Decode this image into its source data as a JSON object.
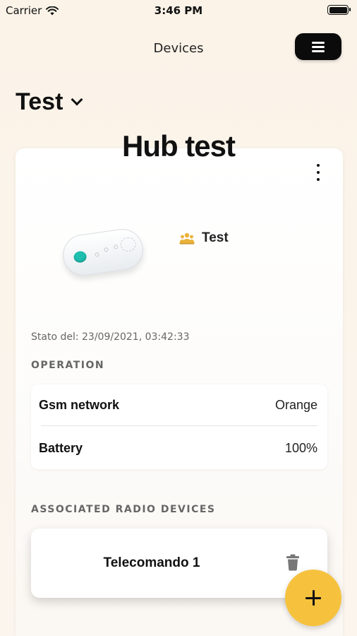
{
  "status_bar": {
    "carrier": "Carrier",
    "time": "3:46 PM",
    "wifi_icon": "wifi-icon",
    "battery_icon": "battery-icon"
  },
  "header": {
    "title": "Devices",
    "menu_icon": "menu-icon"
  },
  "site": {
    "name": "Test",
    "chevron_icon": "chevron-down-icon"
  },
  "hub": {
    "title": "Hub test",
    "more_icon": "more-vertical-icon",
    "owner_icon": "group-icon",
    "owner": "Test",
    "status_date": "Stato del: 23/09/2021, 03:42:33"
  },
  "operation": {
    "label": "OPERATION",
    "rows": [
      {
        "label": "Gsm network",
        "value": "Orange"
      },
      {
        "label": "Battery",
        "value": "100%"
      }
    ]
  },
  "radio_devices": {
    "label": "ASSOCIATED RADIO DEVICES",
    "items": [
      {
        "name": "Telecomando 1",
        "delete_icon": "trash-icon"
      }
    ]
  },
  "fab": {
    "icon": "plus-icon"
  },
  "colors": {
    "background": "#fbf3e8",
    "fab": "#f6c23e",
    "menu_button": "#0b0b0b",
    "device_led": "#1fbfb0",
    "owner_icon": "#e9b23a"
  }
}
